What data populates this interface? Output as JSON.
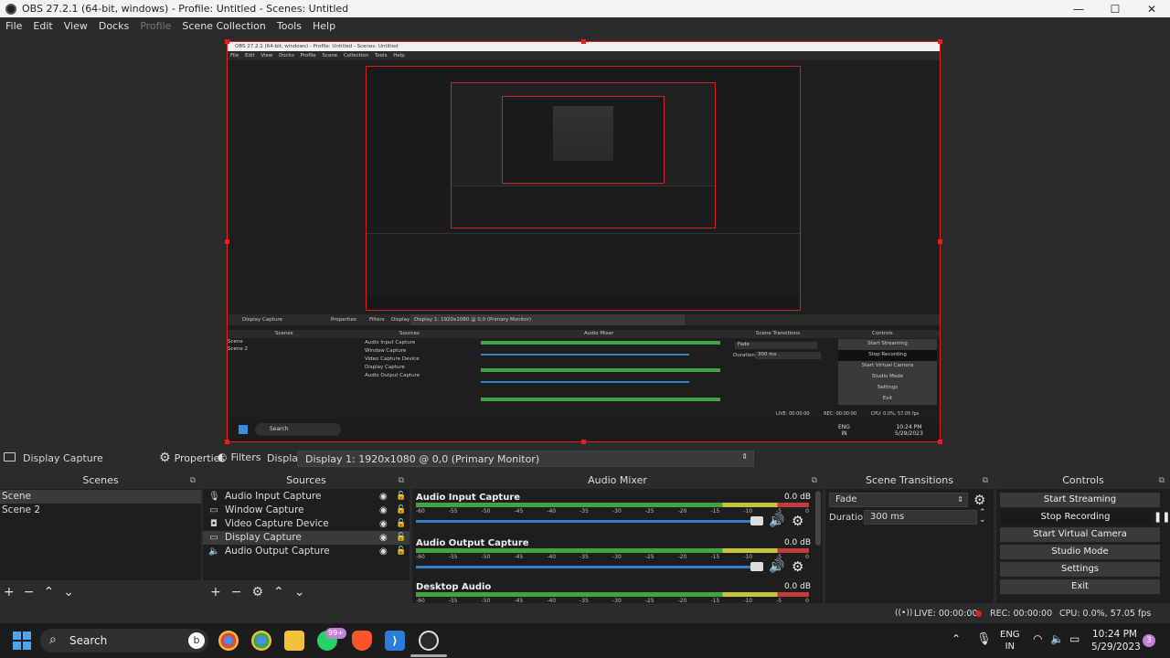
{
  "window": {
    "title": "OBS 27.2.1 (64-bit, windows) - Profile: Untitled - Scenes: Untitled",
    "minimize": "—",
    "maximize": "☐",
    "close": "✕"
  },
  "menu": [
    "File",
    "Edit",
    "View",
    "Docks",
    "Profile",
    "Scene Collection",
    "Tools",
    "Help"
  ],
  "source_toolbar": {
    "source_name": "Display Capture",
    "properties": "Properties",
    "filters": "Filters",
    "display_label": "Display",
    "display_value": "Display 1: 1920x1080 @ 0,0 (Primary Monitor)"
  },
  "scenes": {
    "title": "Scenes",
    "items": [
      "Scene",
      "Scene 2"
    ]
  },
  "sources": {
    "title": "Sources",
    "items": [
      "Audio Input Capture",
      "Window Capture",
      "Video Capture Device",
      "Display Capture",
      "Audio Output Capture"
    ]
  },
  "mixer": {
    "title": "Audio Mixer",
    "ticks": [
      "-60",
      "-55",
      "-50",
      "-45",
      "-40",
      "-35",
      "-30",
      "-25",
      "-20",
      "-15",
      "-10",
      "-5",
      "0"
    ],
    "channels": [
      {
        "name": "Audio Input Capture",
        "db": "0.0 dB"
      },
      {
        "name": "Audio Output Capture",
        "db": "0.0 dB"
      },
      {
        "name": "Desktop Audio",
        "db": "0.0 dB"
      }
    ]
  },
  "transitions": {
    "title": "Scene Transitions",
    "type": "Fade",
    "duration_label": "Duration",
    "duration_value": "300 ms"
  },
  "controls": {
    "title": "Controls",
    "buttons": [
      "Start Streaming",
      "Stop Recording",
      "Start Virtual Camera",
      "Studio Mode",
      "Settings",
      "Exit"
    ]
  },
  "status": {
    "live": "LIVE: 00:00:00",
    "rec": "REC: 00:00:00",
    "cpu": "CPU: 0.0%, 57.05 fps"
  },
  "taskbar": {
    "search": "Search",
    "whatsapp_badge": "99+",
    "lang": "ENG",
    "region": "IN",
    "time": "10:24 PM",
    "date": "5/29/2023",
    "notif": "3"
  },
  "nested": {
    "title": "OBS 27.2.1 (64-bit, windows) - Profile: Untitled - Scenes: Untitled",
    "menu": "File Edit View Docks Profile Scene Collection Tools Help",
    "source": "Display Capture",
    "properties": "Properties",
    "filters": "Filters",
    "display": "Display",
    "display_value": "Display 1: 1920x1080 @ 0,0 (Primary Monitor)",
    "scenes_title": "Scenes",
    "sources_title": "Sources",
    "mixer_title": "Audio Mixer",
    "transitions_title": "Scene Transitions",
    "controls_title": "Controls",
    "fade": "Fade",
    "duration": "Duration",
    "duration_value": "300 ms",
    "search": "Search",
    "lang": "ENG",
    "region": "IN",
    "time": "10:24 PM",
    "date": "5/29/2023",
    "live": "LIVE: 00:00:00",
    "rec": "REC: 00:00:00",
    "cpu": "CPU: 0.0%, 57.05 fps"
  },
  "colors": {
    "accent": "#2f7fd0",
    "selection_border": "#dd2222",
    "panel_bg": "#1e1e1e",
    "window_bg": "#2b2b2b"
  }
}
